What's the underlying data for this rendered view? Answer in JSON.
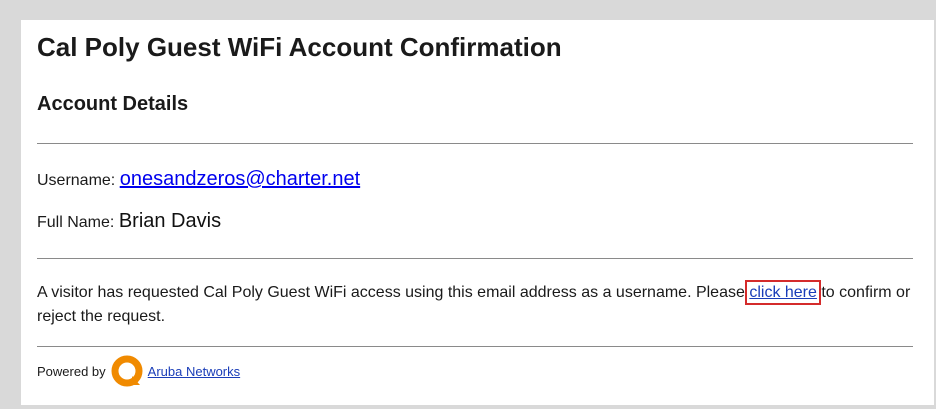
{
  "email": {
    "title": "Cal Poly Guest WiFi Account Confirmation",
    "section_heading": "Account Details",
    "username": {
      "label": "Username:",
      "value": "onesandzeros@charter.net"
    },
    "full_name": {
      "label": "Full Name:",
      "value": "Brian Davis"
    },
    "message": {
      "text_before": "A visitor has requested Cal Poly Guest WiFi access using this email address as a username. Please ",
      "link_label": "click here",
      "text_after": " to confirm or reject the request."
    },
    "footer": {
      "powered_by": "Powered by",
      "logo_icon": "aruba-logo-icon",
      "link_label": "Aruba Networks"
    }
  },
  "colors": {
    "link": "#0000ee",
    "highlight_box": "#d42b2b",
    "logo": "#f08a00"
  }
}
